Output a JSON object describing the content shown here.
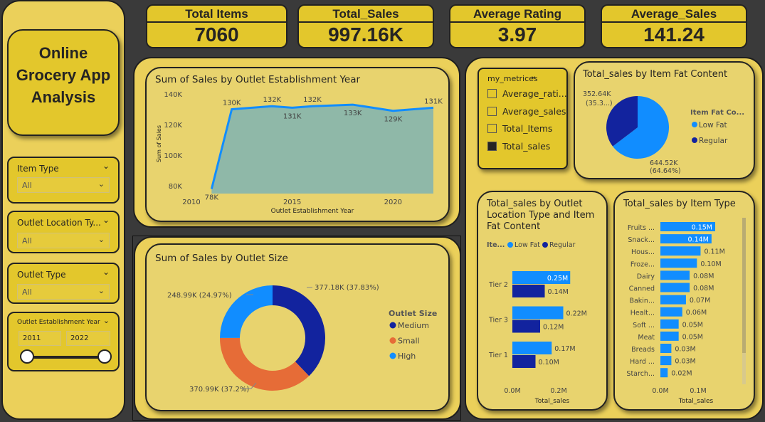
{
  "title": "Online Grocery App Analysis",
  "kpis": [
    {
      "label": "Total Items",
      "value": "7060"
    },
    {
      "label": "Total_Sales",
      "value": "997.16K"
    },
    {
      "label": "Average Rating",
      "value": "3.97"
    },
    {
      "label": "Average_Sales",
      "value": "141.24"
    }
  ],
  "slicers": {
    "item_type": {
      "label": "Item Type",
      "value": "All"
    },
    "outlet_location": {
      "label": "Outlet Location Ty...",
      "value": "All"
    },
    "outlet_type": {
      "label": "Outlet Type",
      "value": "All"
    },
    "establishment_year": {
      "label": "Outlet Establishment Year",
      "from": "2011",
      "to": "2022"
    }
  },
  "metrics_slicer": {
    "label": "my_metrices",
    "options": [
      {
        "label": "Average_rati...",
        "checked": false
      },
      {
        "label": "Average_sales",
        "checked": false
      },
      {
        "label": "Total_Items",
        "checked": false
      },
      {
        "label": "Total_sales",
        "checked": true
      }
    ]
  },
  "colors": {
    "background": "#3a3a3a",
    "card": "#e8d36e",
    "kpi": "#e3c72c",
    "area_line": "#118dff",
    "area_fill": "#8fb8a8",
    "dark_blue": "#12239e",
    "light_blue": "#118dff",
    "orange": "#e66c37"
  },
  "chart_data": [
    {
      "type": "area",
      "title": "Sum of Sales by Outlet Establishment Year",
      "xlabel": "Outlet Establishment Year",
      "ylabel": "Sum of Sales",
      "x": [
        2011,
        2012,
        2014,
        2015,
        2016,
        2018,
        2020,
        2022
      ],
      "values": [
        78000,
        130000,
        132000,
        131000,
        132000,
        133000,
        129000,
        131000
      ],
      "data_labels": [
        "78K",
        "130K",
        "132K",
        "131K",
        "132K",
        "133K",
        "129K",
        "131K"
      ],
      "xticks": [
        "2010",
        "2015",
        "2020"
      ],
      "yticks": [
        "80K",
        "100K",
        "120K",
        "140K"
      ],
      "xlim": [
        2010,
        2022
      ],
      "ylim": [
        75000,
        140000
      ]
    },
    {
      "type": "pie",
      "title": "Sum of Sales by Outlet Size",
      "legend_title": "Outlet Size",
      "categories": [
        "Medium",
        "Small",
        "High"
      ],
      "values": [
        377.18,
        370.99,
        248.99
      ],
      "data_labels": [
        "377.18K (37.83%)",
        "370.99K (37.2%)",
        "248.99K (24.97%)"
      ],
      "colors": [
        "#12239e",
        "#e66c37",
        "#118dff"
      ]
    },
    {
      "type": "pie",
      "title": "Total_sales by Item Fat Content",
      "legend_title": "Item Fat Co...",
      "categories": [
        "Low Fat",
        "Regular"
      ],
      "values": [
        644.52,
        352.64
      ],
      "data_labels": [
        [
          "644.52K",
          "(64.64%)"
        ],
        [
          "352.64K",
          "(35.3...)"
        ]
      ],
      "colors": [
        "#118dff",
        "#12239e"
      ]
    },
    {
      "type": "bar",
      "title": "Total_sales by Outlet Location Type and Item Fat Content",
      "title_lines": [
        "Total_sales by Outlet",
        "Location Type and Item",
        "Fat Content"
      ],
      "legend_title": "Ite...",
      "categories": [
        "Tier 2",
        "Tier 3",
        "Tier 1"
      ],
      "series": [
        {
          "name": "Low Fat",
          "values": [
            0.25,
            0.22,
            0.17
          ],
          "labels": [
            "0.25M",
            "0.22M",
            "0.17M"
          ]
        },
        {
          "name": "Regular",
          "values": [
            0.14,
            0.12,
            0.1
          ],
          "labels": [
            "0.14M",
            "0.12M",
            "0.10M"
          ]
        }
      ],
      "xticks": [
        "0.0M",
        "0.2M"
      ],
      "xlabel": "Total_sales",
      "xlim": [
        0,
        0.3
      ]
    },
    {
      "type": "bar",
      "title": "Total_sales by Item Type",
      "categories": [
        "Fruits ...",
        "Snack...",
        "Hous...",
        "Froze...",
        "Dairy",
        "Canned",
        "Bakin...",
        "Healt...",
        "Soft ...",
        "Meat",
        "Breads",
        "Hard ...",
        "Starch..."
      ],
      "values": [
        0.15,
        0.14,
        0.11,
        0.1,
        0.08,
        0.08,
        0.07,
        0.06,
        0.05,
        0.05,
        0.03,
        0.03,
        0.02
      ],
      "labels": [
        "0.15M",
        "0.14M",
        "0.11M",
        "0.10M",
        "0.08M",
        "0.08M",
        "0.07M",
        "0.06M",
        "0.05M",
        "0.05M",
        "0.03M",
        "0.03M",
        "0.02M"
      ],
      "xticks": [
        "0.0M",
        "0.1M"
      ],
      "xlabel": "Total_sales",
      "xlim": [
        0,
        0.18
      ]
    }
  ]
}
